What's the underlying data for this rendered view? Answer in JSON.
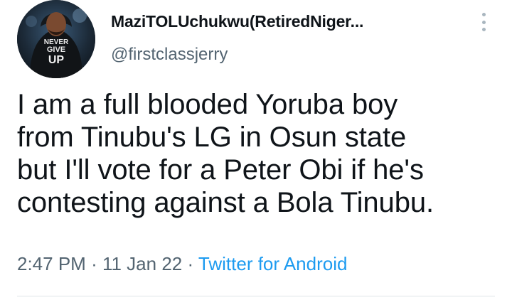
{
  "tweet": {
    "display_name": "MaziTOLUchukwu(RetiredNiger...",
    "handle": "@firstclassjerry",
    "avatar_shirt_text": [
      "NEVER",
      "GIVE",
      "UP"
    ],
    "text": "I am a full blooded Yoruba boy\nfrom Tinubu's LG in Osun state\nbut I'll vote for a Peter Obi if he's\ncontesting against a Bola Tinubu.",
    "time": "2:47 PM",
    "separator": "·",
    "date": "11 Jan 22",
    "source": "Twitter for Android"
  },
  "icons": {
    "more": "more-vertical-icon"
  },
  "colors": {
    "text_primary": "#0f1419",
    "text_secondary": "#536471",
    "link": "#1d9bf0",
    "divider": "#dfe4e7"
  }
}
